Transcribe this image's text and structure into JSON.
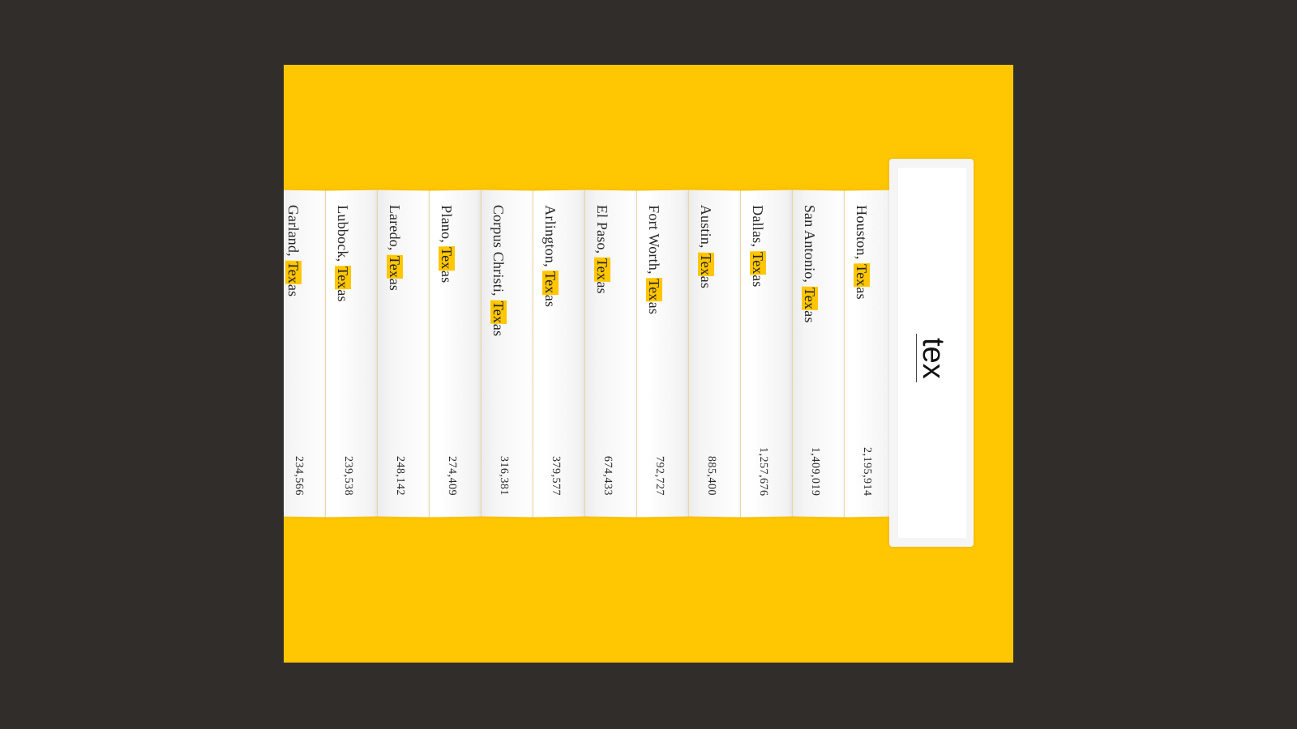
{
  "search": {
    "query": "tex"
  },
  "results": [
    {
      "city_prefix": "Houston, ",
      "match": "Tex",
      "suffix": "as",
      "population": "2,195,914"
    },
    {
      "city_prefix": "San Antonio, ",
      "match": "Tex",
      "suffix": "as",
      "population": "1,409,019"
    },
    {
      "city_prefix": "Dallas, ",
      "match": "Tex",
      "suffix": "as",
      "population": "1,257,676"
    },
    {
      "city_prefix": "Austin, ",
      "match": "Tex",
      "suffix": "as",
      "population": "885,400"
    },
    {
      "city_prefix": "Fort Worth, ",
      "match": "Tex",
      "suffix": "as",
      "population": "792,727"
    },
    {
      "city_prefix": "El Paso, ",
      "match": "Tex",
      "suffix": "as",
      "population": "674,433"
    },
    {
      "city_prefix": "Arlington, ",
      "match": "Tex",
      "suffix": "as",
      "population": "379,577"
    },
    {
      "city_prefix": "Corpus Christi, ",
      "match": "Tex",
      "suffix": "as",
      "population": "316,381"
    },
    {
      "city_prefix": "Plano, ",
      "match": "Tex",
      "suffix": "as",
      "population": "274,409"
    },
    {
      "city_prefix": "Laredo, ",
      "match": "Tex",
      "suffix": "as",
      "population": "248,142"
    },
    {
      "city_prefix": "Lubbock, ",
      "match": "Tex",
      "suffix": "as",
      "population": "239,538"
    },
    {
      "city_prefix": "Garland, ",
      "match": "Tex",
      "suffix": "as",
      "population": "234,566"
    }
  ],
  "colors": {
    "background": "#302d2b",
    "accent": "#ffc601",
    "card": "#ffffff"
  }
}
